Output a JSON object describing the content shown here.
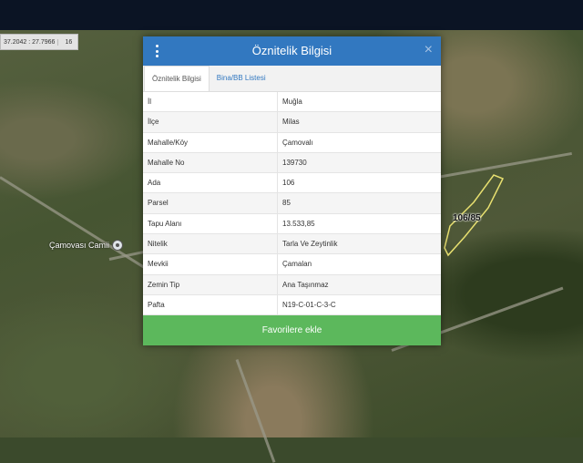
{
  "map": {
    "coordinates": "37.2042 : 27.7966",
    "zoom": "16",
    "poi_label": "Çamovası Camii",
    "parcel_label": "106/85"
  },
  "modal": {
    "title": "Öznitelik Bilgisi",
    "close_symbol": "×",
    "tabs": [
      {
        "label": "Öznitelik Bilgisi",
        "active": true
      },
      {
        "label": "Bina/BB Listesi",
        "active": false
      }
    ],
    "rows": [
      {
        "key": "İl",
        "value": "Muğla"
      },
      {
        "key": "İlçe",
        "value": "Milas"
      },
      {
        "key": "Mahalle/Köy",
        "value": "Çamovalı"
      },
      {
        "key": "Mahalle No",
        "value": "139730"
      },
      {
        "key": "Ada",
        "value": "106"
      },
      {
        "key": "Parsel",
        "value": "85"
      },
      {
        "key": "Tapu Alanı",
        "value": "13.533,85"
      },
      {
        "key": "Nitelik",
        "value": "Tarla Ve Zeytinlik"
      },
      {
        "key": "Mevkii",
        "value": "Çamalan"
      },
      {
        "key": "Zemin Tip",
        "value": "Ana Taşınmaz"
      },
      {
        "key": "Pafta",
        "value": "N19-C-01-C-3-C"
      }
    ],
    "favorite_button": "Favorilere ekle"
  },
  "colors": {
    "header": "#3278c0",
    "button": "#5cb85c",
    "topbar": "#0b1424"
  },
  "icons": [
    "kebab-menu-icon",
    "close-icon",
    "mosque-pin-icon"
  ]
}
